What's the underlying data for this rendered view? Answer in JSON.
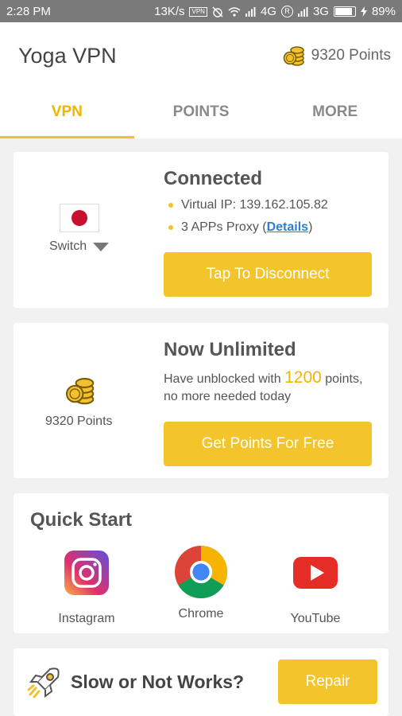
{
  "status_bar": {
    "time": "2:28 PM",
    "speed": "13K/s",
    "vpn_badge": "VPN",
    "network_4g": "4G",
    "roaming": "R",
    "network_3g": "3G",
    "battery": "89%",
    "battery_level": 0.89
  },
  "header": {
    "app_title": "Yoga VPN",
    "points": "9320 Points"
  },
  "tabs": [
    {
      "label": "VPN",
      "active": true
    },
    {
      "label": "POINTS",
      "active": false
    },
    {
      "label": "MORE",
      "active": false
    }
  ],
  "connection": {
    "status": "Connected",
    "virtual_ip": "Virtual IP: 139.162.105.82",
    "apps_proxy_prefix": "3 APPs Proxy (",
    "details_link": "Details",
    "apps_proxy_suffix": ")",
    "switch_label": "Switch",
    "button": "Tap To Disconnect",
    "flag_icon": "japan-flag-icon"
  },
  "points_card": {
    "title": "Now Unlimited",
    "desc_prefix": "Have unblocked with ",
    "desc_points": "1200",
    "desc_suffix": " points,",
    "desc_line2": "no more needed today",
    "points_label": "9320 Points",
    "button": "Get Points For Free"
  },
  "quick_start": {
    "title": "Quick Start",
    "apps": [
      {
        "label": "Instagram",
        "icon": "instagram-icon"
      },
      {
        "label": "Chrome",
        "icon": "chrome-icon"
      },
      {
        "label": "YouTube",
        "icon": "youtube-icon"
      }
    ]
  },
  "repair_card": {
    "text": "Slow or Not Works?",
    "button": "Repair"
  },
  "colors": {
    "accent": "#f4c42d",
    "tab_active": "#f1b500",
    "link": "#2f7fd1"
  }
}
